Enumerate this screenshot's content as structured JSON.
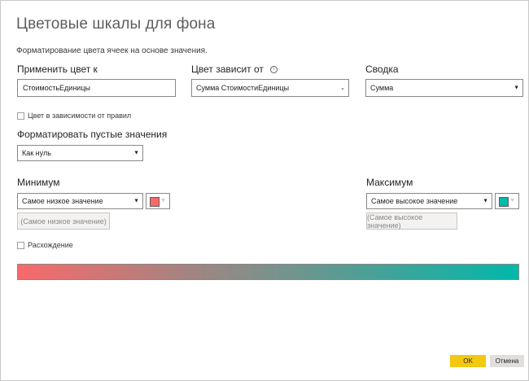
{
  "dialog": {
    "title": "Цветовые шкалы для фона",
    "subtitle": "Форматирование цвета ячеек на основе значения."
  },
  "apply_to": {
    "label": "Применить цвет к",
    "value": "СтоимостьЕдиницы"
  },
  "based_on": {
    "label": "Цвет зависит от",
    "value": "Сумма СтоимостиЕдиницы",
    "icon": "info-icon"
  },
  "summary": {
    "label": "Сводка",
    "value": "Сумма"
  },
  "rules_checkbox": {
    "label": "Цвет в зависимости от правил",
    "checked": false
  },
  "blank_values": {
    "label": "Форматировать пустые значения",
    "value": "Как нуль"
  },
  "minimum": {
    "label": "Минимум",
    "value": "Самое низкое значение",
    "placeholder": "(Самое низкое значение)",
    "color": "#f8696b"
  },
  "maximum": {
    "label": "Максимум",
    "value": "Самое высокое значение",
    "placeholder": "(Самое высокое значение)",
    "color": "#01b8aa"
  },
  "diverging_checkbox": {
    "label": "Расхождение",
    "checked": false
  },
  "buttons": {
    "ok": "OK",
    "cancel": "Отмена"
  },
  "colors": {
    "accent": "#f2c811"
  }
}
